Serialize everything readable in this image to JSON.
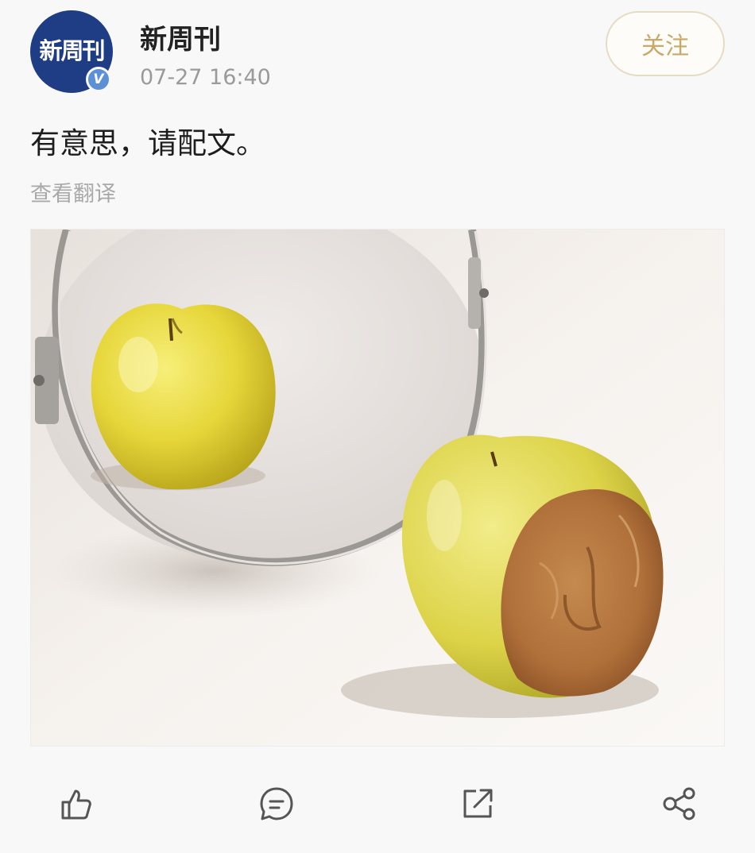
{
  "account": {
    "name": "新周刊",
    "avatar_text": "新周刊",
    "verified_mark": "V",
    "time": "07-27 16:40",
    "follow_label": "关注"
  },
  "post": {
    "text": "有意思，请配文。",
    "translate_label": "查看翻译"
  },
  "image": {
    "subject": "apple-mirror-photo"
  },
  "actions": [
    {
      "icon": "thumbs-up-icon"
    },
    {
      "icon": "comment-icon"
    },
    {
      "icon": "share-box-icon"
    },
    {
      "icon": "share-nodes-icon"
    }
  ],
  "colors": {
    "avatar_bg": "#1e3d84",
    "follow_text": "#c9a96a",
    "verified_badge": "#5d8fd6"
  }
}
